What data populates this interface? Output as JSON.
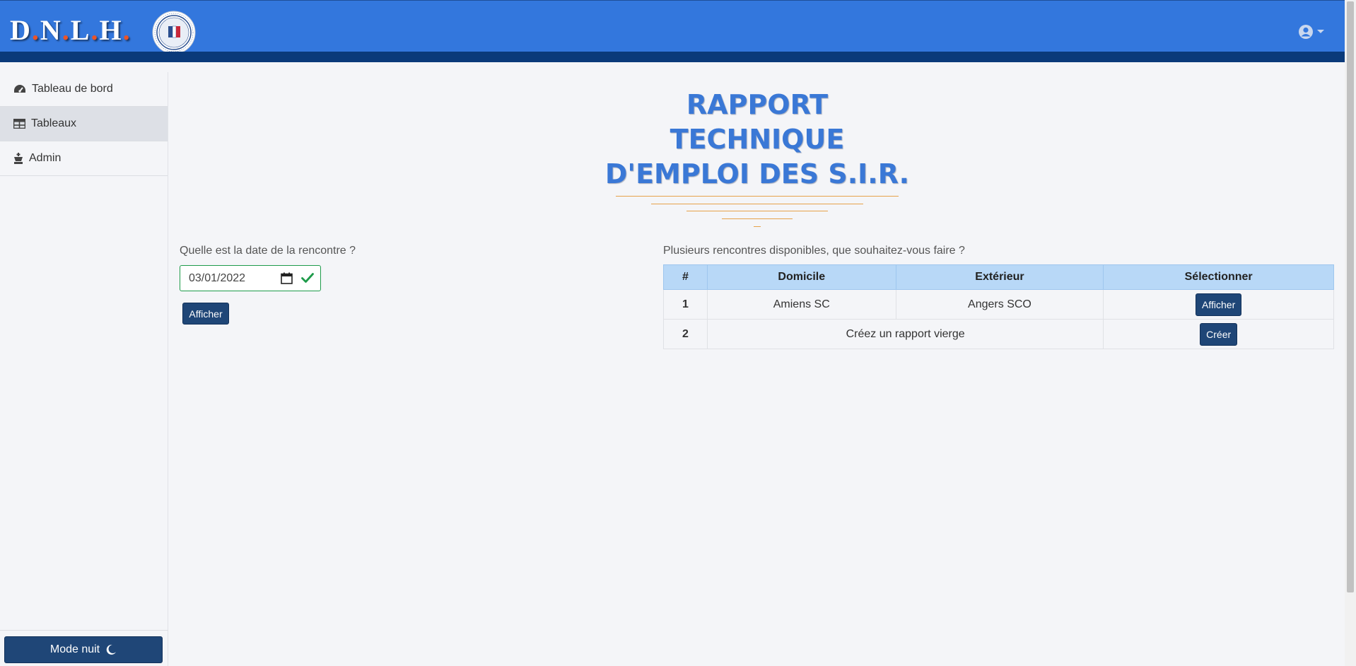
{
  "header": {
    "brand_letters": [
      "D",
      "N",
      "L",
      "H"
    ],
    "brand_dot": ".",
    "logo": "seal-logo",
    "user_icon": "user-circle-icon",
    "caret_icon": "caret-down-icon"
  },
  "sidebar": {
    "items": [
      {
        "label": "Tableau de bord",
        "icon": "tachometer-icon"
      },
      {
        "label": "Tableaux",
        "icon": "table-icon"
      },
      {
        "label": "Admin",
        "icon": "chess-king-icon"
      }
    ],
    "night_mode_label": "Mode nuit",
    "night_mode_icon": "moon-icon"
  },
  "main": {
    "title_lines": [
      "RAPPORT",
      "TECHNIQUE",
      "D'EMPLOI DES S.I.R."
    ],
    "date_question": "Quelle est la date de la rencontre ?",
    "date_value": "03/01/2022",
    "show_button": "Afficher",
    "matches_question": "Plusieurs rencontres disponibles, que souhaitez-vous faire ?",
    "table": {
      "headers": [
        "#",
        "Domicile",
        "Extérieur",
        "Sélectionner"
      ],
      "rows": [
        {
          "num": "1",
          "home": "Amiens SC",
          "away": "Angers SCO",
          "action": "Afficher"
        },
        {
          "num": "2",
          "text": "Créez un rapport vierge",
          "action": "Créer"
        }
      ]
    }
  },
  "colors": {
    "header_blue": "#3377dd",
    "header_stripe": "#0a3a7a",
    "title_blue": "#3a78d6",
    "accent_orange": "#e6a24a",
    "button_navy": "#1f4677",
    "table_header": "#b8d8f7",
    "valid_green": "#1e9b4a"
  }
}
